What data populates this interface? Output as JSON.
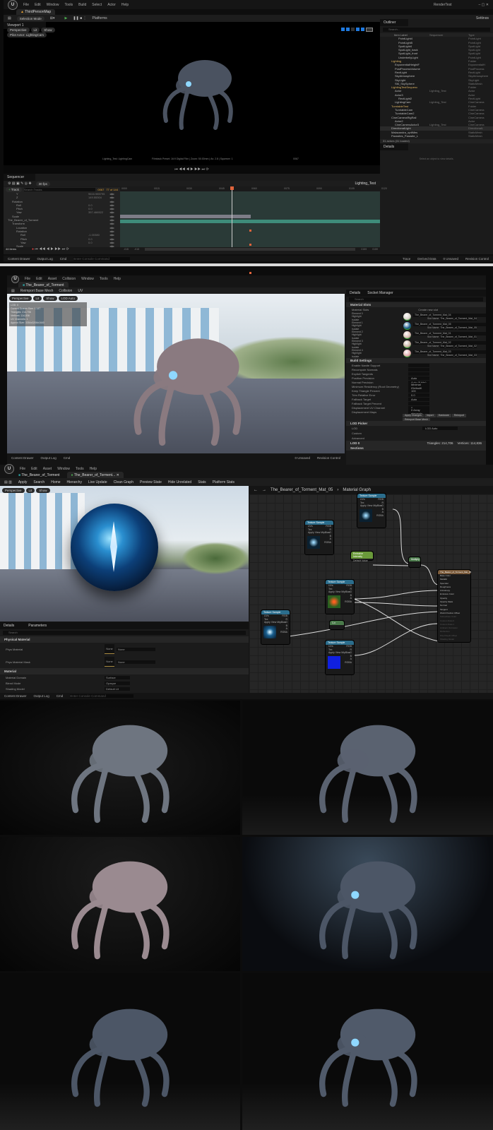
{
  "shot1": {
    "menu": [
      "File",
      "Edit",
      "Window",
      "Tools",
      "Build",
      "Select",
      "Actor",
      "Help"
    ],
    "project": "RenderTest",
    "map_tab": "ThirdPersonMap",
    "selection_mode": "Selection Mode",
    "platforms": "Platforms",
    "settings": "Settings",
    "viewport_tab": "Viewport 1",
    "viewport_buttons": [
      "Perspective",
      "Lit",
      "Show"
    ],
    "pilot": "Pilot Actor: LightingCam",
    "overlay_left": "Lighting_Test: LightingCam",
    "overlay_center": "Filmback Preset: 16:9 Digital Film | Zoom: 50.00mm | Av: 2.8 | Squeeze: 1",
    "overlay_right": "0067",
    "outliner": {
      "title": "Outliner",
      "search_placeholder": "Search...",
      "columns": [
        "Item Label",
        "Sequencer",
        "Type"
      ],
      "items": [
        {
          "label": "PointLight4",
          "seq": "",
          "type": "PointLight",
          "indent": 4
        },
        {
          "label": "PointLight5",
          "seq": "",
          "type": "PointLight",
          "indent": 4
        },
        {
          "label": "SpotLight4",
          "seq": "",
          "type": "SpotLight",
          "indent": 4
        },
        {
          "label": "SpotLight_back",
          "seq": "",
          "type": "SpotLight",
          "indent": 4
        },
        {
          "label": "SpotLight_front",
          "seq": "",
          "type": "SpotLight",
          "indent": 4
        },
        {
          "label": "UnderbellyLight",
          "seq": "",
          "type": "PointLight",
          "indent": 4
        },
        {
          "label": "Lighting",
          "seq": "",
          "type": "Folder",
          "indent": 2
        },
        {
          "label": "ExponentialHeightF",
          "seq": "",
          "type": "ExponentialH",
          "indent": 3
        },
        {
          "label": "PostProcessVolume",
          "seq": "",
          "type": "PostProcess",
          "indent": 3
        },
        {
          "label": "RectLight",
          "seq": "",
          "type": "RectLight",
          "indent": 3
        },
        {
          "label": "SkyAtmosphere",
          "seq": "",
          "type": "SkyAtmosphere",
          "indent": 3
        },
        {
          "label": "SkyLight",
          "seq": "",
          "type": "SkyLight",
          "indent": 3
        },
        {
          "label": "SM_SkySphere",
          "seq": "",
          "type": "StaticMesh",
          "indent": 3
        },
        {
          "label": "LightingTestSequenc",
          "seq": "",
          "type": "Folder",
          "indent": 2
        },
        {
          "label": "Actor",
          "seq": "Lighting_Test",
          "type": "Actor",
          "indent": 3
        },
        {
          "label": "Actor3",
          "seq": "",
          "type": "Actor",
          "indent": 3
        },
        {
          "label": "RectLight2",
          "seq": "",
          "type": "RectLight",
          "indent": 4
        },
        {
          "label": "LightingCam",
          "seq": "Lighting_Test",
          "type": "CineCamera",
          "indent": 3
        },
        {
          "label": "TurntableTest",
          "seq": "",
          "type": "Folder",
          "indent": 2
        },
        {
          "label": "TurntableCam",
          "seq": "",
          "type": "CineCamera",
          "indent": 3
        },
        {
          "label": "TurntableCam2",
          "seq": "",
          "type": "CineCamera",
          "indent": 3
        },
        {
          "label": "CineCameraRigRail",
          "seq": "",
          "type": "CineCamera",
          "indent": 2
        },
        {
          "label": "Actor2",
          "seq": "",
          "type": "Actor",
          "indent": 3
        },
        {
          "label": "CineCameraActor3",
          "seq": "Lighting_Test",
          "type": "CineCamera",
          "indent": 3
        },
        {
          "label": "DirectionalLight",
          "seq": "",
          "type": "DirectionalL",
          "indent": 2
        },
        {
          "label": "Malacandra_optiMes",
          "seq": "",
          "type": "StaticMesh",
          "indent": 2
        },
        {
          "label": "Parasites_Parasite_L",
          "seq": "",
          "type": "StaticMesh",
          "indent": 2
        }
      ],
      "count": "31 actors (31 loaded)"
    },
    "details": {
      "title": "Details",
      "empty": "Select an object to view details."
    },
    "sequencer": {
      "tab": "Sequencer",
      "fps": "30 fps",
      "add_track": "Track",
      "search_placeholder": "Search Tracks",
      "frame": "0067",
      "frame_of": "77 of 144",
      "sequence_name": "Lighting_Test",
      "tracks": [
        {
          "label": "Y",
          "value": "9616.985795",
          "indent": 2
        },
        {
          "label": "Z",
          "value": "149.55304",
          "indent": 2
        },
        {
          "label": "Rotation",
          "value": "",
          "indent": 1
        },
        {
          "label": "Roll",
          "value": "0.0",
          "indent": 2
        },
        {
          "label": "Pitch",
          "value": "0.0",
          "indent": 2
        },
        {
          "label": "Yaw",
          "value": "357.466522",
          "indent": 2
        },
        {
          "label": "Scale",
          "value": "",
          "indent": 1
        },
        {
          "label": "The_Bearer_of_Torment",
          "value": "",
          "indent": 0
        },
        {
          "label": "Transform",
          "value": "",
          "indent": 1
        },
        {
          "label": "Location",
          "value": "",
          "indent": 2
        },
        {
          "label": "Rotation",
          "value": "",
          "indent": 2
        },
        {
          "label": "Roll",
          "value": "-1.00380",
          "indent": 3
        },
        {
          "label": "Pitch",
          "value": "0.0",
          "indent": 3
        },
        {
          "label": "Yaw",
          "value": "0.0",
          "indent": 3
        },
        {
          "label": "Scale",
          "value": "",
          "indent": 2
        }
      ],
      "item_count": "44 items",
      "ruler": [
        "0000",
        "0015",
        "0030",
        "0045",
        "0060",
        "0075",
        "0090",
        "0105",
        "0120"
      ],
      "range_start": "-015",
      "range_start2": "-015",
      "range_end": "0159",
      "range_end2": "0159"
    },
    "status": {
      "content_drawer": "Content Drawer",
      "output_log": "Output Log",
      "cmd": "Cmd",
      "console_placeholder": "Enter Console Command",
      "trace": "Trace",
      "derived_data": "Derived Data",
      "unsaved": "0 Unsaved",
      "revision": "Revision Control"
    }
  },
  "shot2": {
    "menu": [
      "File",
      "Edit",
      "Asset",
      "Collision",
      "Window",
      "Tools",
      "Help"
    ],
    "asset_tab": "The_Bearer_of_Torment",
    "toolbar": [
      "Reimport Base Mesh",
      "Collision",
      "UV"
    ],
    "viewport_buttons": [
      "Perspective",
      "Lit",
      "Show",
      "LOD Auto"
    ],
    "stats": [
      "LOD: 0",
      "Current Screen Size: 1.147",
      "Triangles: 214,706",
      "Vertices: 114,836",
      "UV Channels: 1",
      "Approx Size: 3354x3206x1640"
    ],
    "details_tab": "Details",
    "socket_tab": "Socket Manager",
    "search_placeholder": "Search",
    "material_slots": {
      "title": "Material Slots",
      "label": "Material Slots",
      "button": "Create new slot",
      "elements": [
        {
          "name": "Element 0",
          "material": "The_Bearer_of_Torment_Mat_04",
          "slot": "The_Bearer_of_Torment_Mat_04",
          "tint": "#d8d0c8"
        },
        {
          "name": "Element 1",
          "material": "The_Bearer_of_Torment_Mat_05",
          "slot": "The_Bearer_of_Torment_Mat_05",
          "tint": "#1a5a8a"
        },
        {
          "name": "Element 2",
          "material": "The_Bearer_of_Torment_Mat_01",
          "slot": "The_Bearer_of_Torment_Mat_01",
          "tint": "#d9b8b0"
        },
        {
          "name": "Element 3",
          "material": "The_Bearer_of_Torment_Mat_02",
          "slot": "The_Bearer_of_Torment_Mat_02",
          "tint": "#c8b0a0"
        },
        {
          "name": "Element 4",
          "material": "The_Bearer_of_Torment_Mat_03",
          "slot": "The_Bearer_of_Torment_Mat_03",
          "tint": "#e0a8a8"
        }
      ],
      "highlight": "Highlight",
      "isolate": "Isolate",
      "slot_name": "Slot Name"
    },
    "build_settings": {
      "title": "Build Settings",
      "rows": [
        {
          "label": "Enable Nanite Support",
          "value": ""
        },
        {
          "label": "Recompute Normals",
          "value": ""
        },
        {
          "label": "Explicit Tangents",
          "value": ""
        },
        {
          "label": "Position Precision",
          "value": "Auto"
        },
        {
          "label": "Normal Precision",
          "value": "Auto (8 bits)"
        },
        {
          "label": "Minimum Residency (Root Geometry)",
          "value": "Minimal (Default)"
        },
        {
          "label": "Keep Triangle Percent",
          "value": "100"
        },
        {
          "label": "Trim Relative Error",
          "value": "0.0"
        },
        {
          "label": "Fallback Target",
          "value": "Auto"
        },
        {
          "label": "Fallback Target Percent",
          "value": ""
        },
        {
          "label": "Displacement UV Channel",
          "value": "0"
        },
        {
          "label": "Displacement Maps",
          "value": "0 Array elements"
        }
      ],
      "buttons": [
        "Apply Changes",
        "Import",
        "Hardware",
        "Reimport",
        "Reimport Base Mesh"
      ]
    },
    "lod_picker": {
      "title": "LOD Picker",
      "lod_label": "LOD",
      "lod_value": "LOD Auto",
      "custom": "Custom"
    },
    "advanced": "Advanced",
    "lod0": {
      "title": "LOD 0",
      "tris": "Triangles: 214,706",
      "verts": "Vertices: 114,836"
    },
    "sections": "Sections",
    "status": {
      "content_drawer": "Content Drawer",
      "output_log": "Output Log",
      "cmd": "Cmd",
      "unsaved": "0 Unsaved",
      "revision": "Revision Control"
    }
  },
  "shot3": {
    "menu": [
      "File",
      "Edit",
      "Asset",
      "Window",
      "Tools",
      "Help"
    ],
    "tabs": [
      "The_Bearer_of_Torment",
      "The_Bearer_of_Torment..."
    ],
    "toolbar": [
      "Apply",
      "Search",
      "Home",
      "Hierarchy",
      "Live Update",
      "Clean Graph",
      "Preview State",
      "Hide Unrelated",
      "Stats",
      "Platform Stats"
    ],
    "viewport_buttons": [
      "Perspective",
      "Lit",
      "Show"
    ],
    "details_tab": "Details",
    "parameters_tab": "Parameters",
    "search_placeholder": "Search",
    "physical_material": {
      "title": "Physical Material",
      "rows": [
        {
          "label": "Phys Material",
          "thumb": "None",
          "value": "None"
        },
        {
          "label": "Phys Material Mask",
          "thumb": "None",
          "value": "None"
        }
      ]
    },
    "material": {
      "title": "Material",
      "rows": [
        {
          "label": "Material Domain",
          "value": "Surface"
        },
        {
          "label": "Blend Mode",
          "value": "Opaque"
        },
        {
          "label": "Shading Model",
          "value": "Default Lit"
        }
      ]
    },
    "breadcrumb": {
      "asset": "The_Bearer_of_Torment_Mat_05",
      "graph": "Material Graph"
    },
    "nodes": {
      "texture_sample": "Texture Sample",
      "pins": [
        "UVs",
        "Tex",
        "Apply View MipBias"
      ],
      "outputs": [
        "RGB",
        "R",
        "G",
        "B",
        "A",
        "RGBA"
      ],
      "multiply": "Multiply",
      "scalar": "Emissive Intensity",
      "scalar_value": "Default Value",
      "one_minus": "1-x",
      "result": "The_Bearer_of_Torment_Mat_05",
      "result_pins": [
        "Base Color",
        "Metallic",
        "Specular",
        "Roughness",
        "Anisotropy",
        "Emissive Color",
        "Opacity",
        "Opacity Mask",
        "Normal",
        "Tangent",
        "World Position Offset",
        "Subsurface Color",
        "Custom Data 0",
        "Custom Data 1",
        "Ambient Occlusion",
        "Refraction",
        "Pixel Depth Offset",
        "Shading Model"
      ]
    },
    "status": {
      "content_drawer": "Content Drawer",
      "output_log": "Output Log",
      "cmd": "Cmd",
      "console_placeholder": "Enter Console Command"
    }
  },
  "colors": {
    "accent": "#1f7ae0",
    "play": "#4caf50",
    "playhead": "#e0643c",
    "track": "#3e8c7a",
    "node_header": "#2b6d8c",
    "node_green": "#6a9a3a"
  }
}
